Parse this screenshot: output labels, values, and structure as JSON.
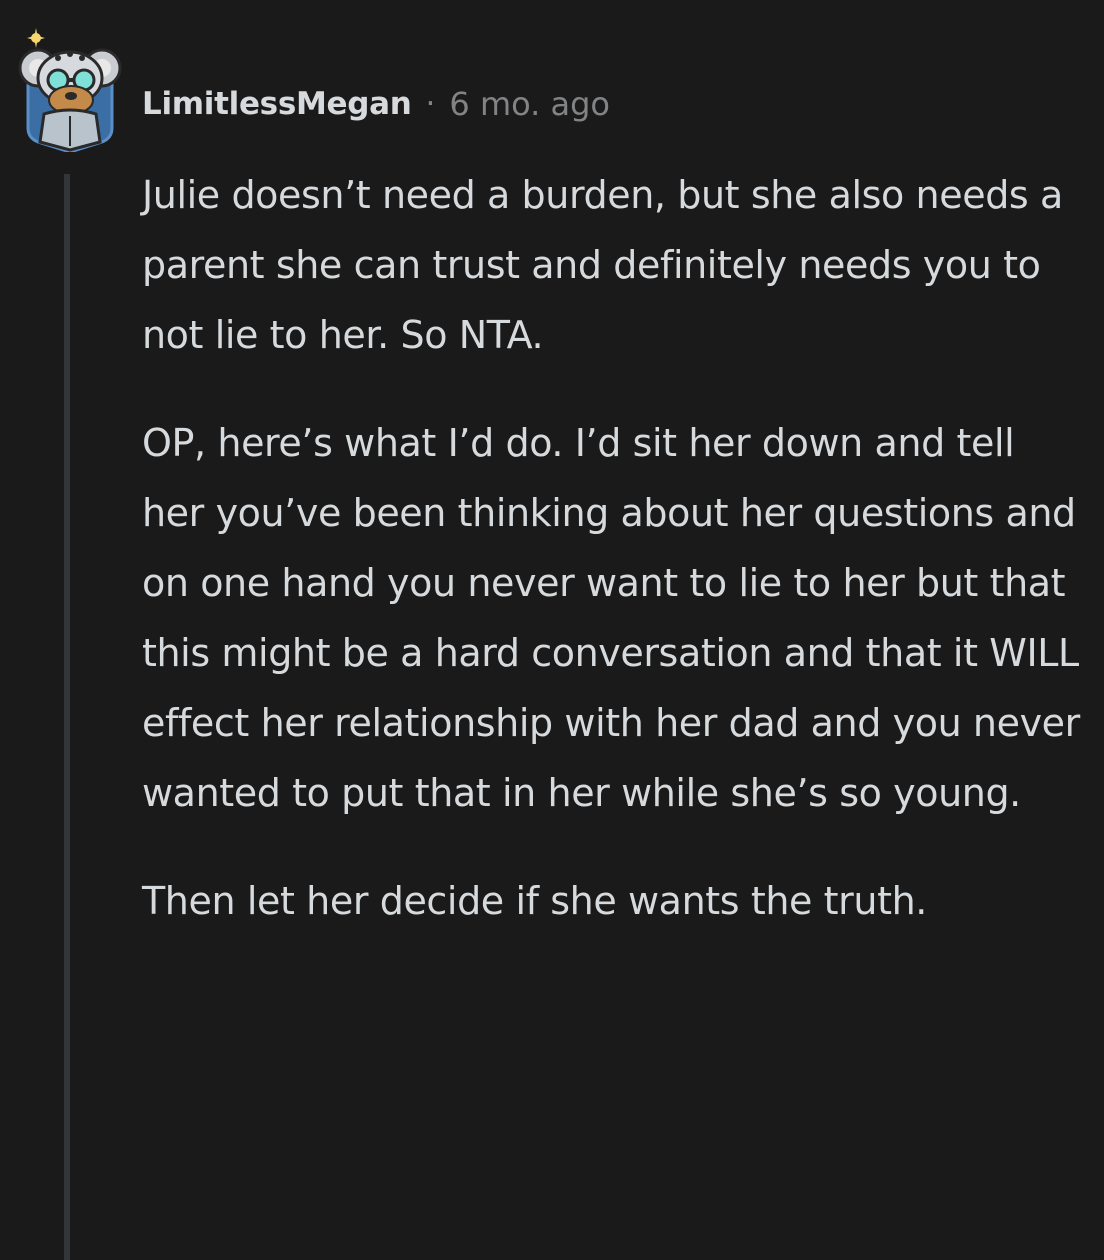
{
  "comment": {
    "username": "LimitlessMegan",
    "separator": "·",
    "timestamp": "6 mo. ago",
    "avatar_icon": "koala-avatar-icon",
    "paragraphs": [
      "Julie doesn’t need a burden, but she also needs a parent she can trust and definitely needs you to not lie to her. So NTA.",
      "OP, here’s what I’d do. I’d sit her down and tell her you’ve been thinking about her questions and on one hand you never want to lie to her but that this might be a hard conversation and that it WILL effect her relationship with her dad and you never wanted to put that in her while she’s so young.",
      "Then let her decide if she wants the truth."
    ]
  },
  "colors": {
    "background": "#1a1a1b",
    "text": "#d7dadc",
    "meta": "#818384",
    "thread_line": "#343536"
  }
}
